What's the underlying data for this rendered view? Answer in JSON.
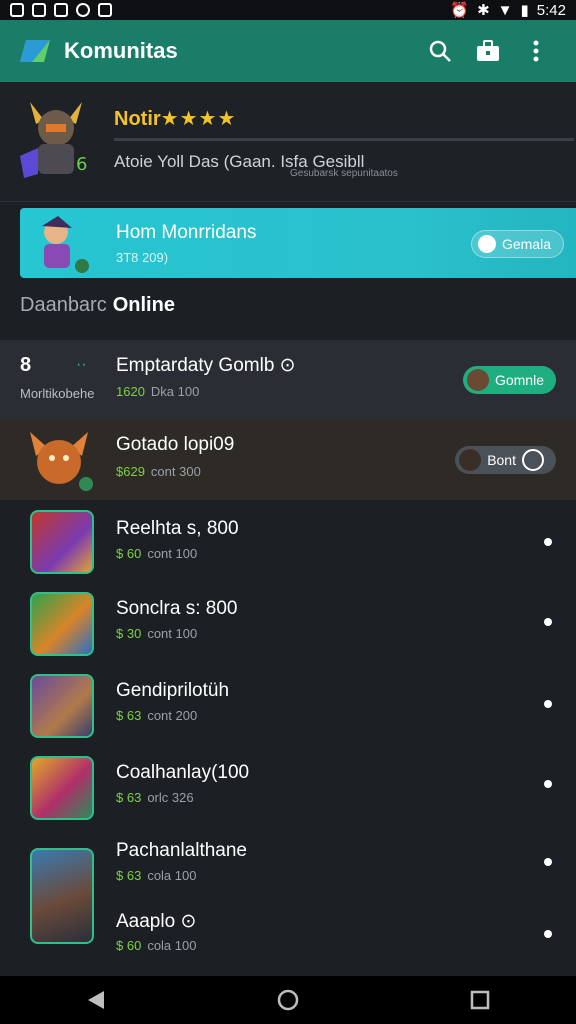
{
  "status": {
    "time": "5:42"
  },
  "appbar": {
    "title": "Komunitas"
  },
  "hero": {
    "title": "Notir",
    "stars": "★★★★",
    "subtitle": "Atoie Yoll Das (Gaan. Isfa Gesibll",
    "subtitle_small": "Gesubarsk sepunitaatos"
  },
  "promo": {
    "title": "Hom Monrridans",
    "sub": "3T8 209)",
    "button": "Gemala"
  },
  "section": {
    "muted": "Daanbarc",
    "strong": "Online"
  },
  "featured": [
    {
      "title": "Emptardaty Gomlb ⊙",
      "meta_g": "1620",
      "meta": "Dka 100",
      "left_top": "8",
      "left_label": "Morltikobehe",
      "chip": "Gomnle"
    },
    {
      "title": "Gotado lopi09",
      "meta_g": "$629",
      "meta": "cont 300",
      "chip": "Bont"
    }
  ],
  "games": [
    {
      "title": "Reelhta s, 800",
      "meta_g": "$ 60",
      "meta": "cont 100"
    },
    {
      "title": "Sonclra s: 800",
      "meta_g": "$ 30",
      "meta": "cont 100"
    },
    {
      "title": "Gendiprilotüh",
      "meta_g": "$ 63",
      "meta": "cont 200"
    },
    {
      "title": "Coalhanlay(100",
      "meta_g": "$ 63",
      "meta": "orlc 326"
    },
    {
      "title": "Pachanlalthane",
      "meta_g": "$ 63",
      "meta": "cola 100"
    },
    {
      "title": "Aaaplo ⊙",
      "meta_g": "$ 60",
      "meta": "cola 100"
    }
  ],
  "colors": {
    "appbar": "#1a7d68",
    "accent_green": "#2fc08a",
    "promo_cyan": "#26c6d2",
    "star": "#f3c42a"
  }
}
